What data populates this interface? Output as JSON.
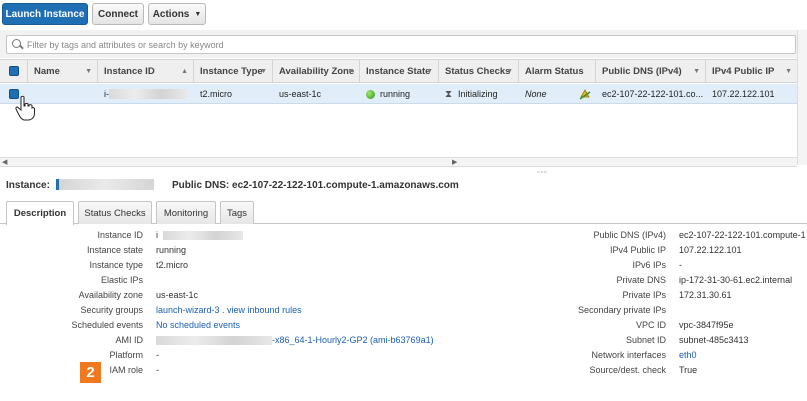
{
  "toolbar": {
    "launch_label": "Launch Instance",
    "connect_label": "Connect",
    "actions_label": "Actions"
  },
  "search": {
    "placeholder": "Filter by tags and attributes or search by keyword"
  },
  "table": {
    "columns": [
      "Name",
      "Instance ID",
      "Instance Type",
      "Availability Zone",
      "Instance State",
      "Status Checks",
      "Alarm Status",
      "Public DNS (IPv4)",
      "IPv4 Public IP"
    ],
    "row": {
      "name": "",
      "instance_id_prefix": "i-",
      "instance_type": "t2.micro",
      "availability_zone": "us-east-1c",
      "instance_state": "running",
      "status_checks": "Initializing",
      "alarm_status": "None",
      "public_dns": "ec2-107-22-122-101.co...",
      "ipv4_public_ip": "107.22.122.101"
    }
  },
  "detail": {
    "instance_label": "Instance:",
    "public_dns_label": "Public DNS: ec2-107-22-122-101.compute-1.amazonaws.com",
    "tabs": [
      "Description",
      "Status Checks",
      "Monitoring",
      "Tags"
    ],
    "left": [
      {
        "label": "Instance ID",
        "value": "i"
      },
      {
        "label": "Instance state",
        "value": "running"
      },
      {
        "label": "Instance type",
        "value": "t2.micro"
      },
      {
        "label": "Elastic IPs",
        "value": ""
      },
      {
        "label": "Availability zone",
        "value": "us-east-1c"
      },
      {
        "label": "Security groups",
        "value": "launch-wizard-3 . view inbound rules"
      },
      {
        "label": "Scheduled events",
        "value": "No scheduled events"
      },
      {
        "label": "AMI ID",
        "value": "-x86_64-1-Hourly2-GP2 (ami-b63769a1)"
      },
      {
        "label": "Platform",
        "value": "-"
      },
      {
        "label": "IAM role",
        "value": "-"
      }
    ],
    "right": [
      {
        "label": "Public DNS (IPv4)",
        "value": "ec2-107-22-122-101.compute-1"
      },
      {
        "label": "IPv4 Public IP",
        "value": "107.22.122.101"
      },
      {
        "label": "IPv6 IPs",
        "value": "-"
      },
      {
        "label": "Private DNS",
        "value": "ip-172-31-30-61.ec2.internal"
      },
      {
        "label": "Private IPs",
        "value": "172.31.30.61"
      },
      {
        "label": "Secondary private IPs",
        "value": ""
      },
      {
        "label": "VPC ID",
        "value": "vpc-3847f95e"
      },
      {
        "label": "Subnet ID",
        "value": "subnet-485c3413"
      },
      {
        "label": "Network interfaces",
        "value": "eth0"
      },
      {
        "label": "Source/dest. check",
        "value": "True"
      }
    ],
    "step_number": "2"
  },
  "colors": {
    "primary": "#1f6fb4",
    "selected_row": "#e1edf9",
    "link": "#1a5fb4",
    "badge": "#f0781e"
  }
}
